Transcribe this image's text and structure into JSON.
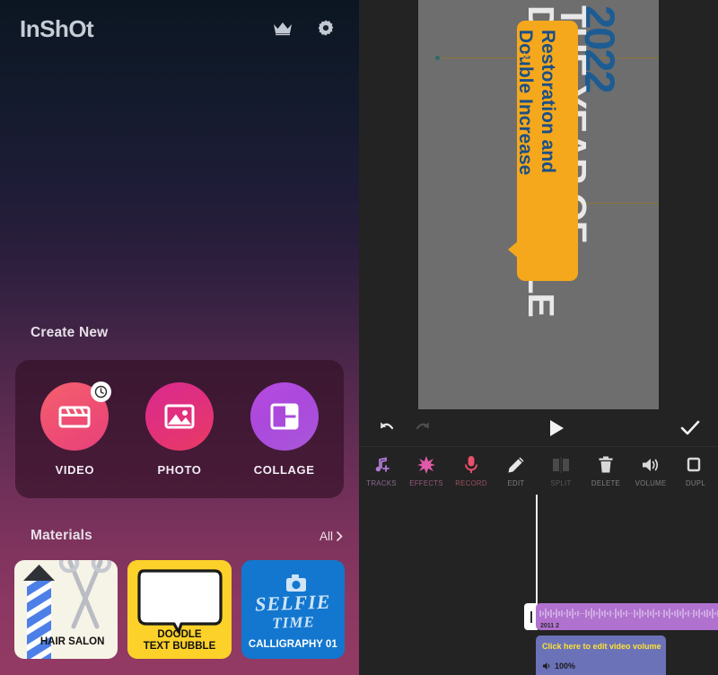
{
  "app": {
    "logo": "InShOt",
    "crown_icon": "crown-icon",
    "gear_icon": "gear-icon"
  },
  "create_new": {
    "title": "Create New",
    "items": [
      {
        "label": "VIDEO",
        "icon": "clapperboard-icon",
        "badge": "clock-icon",
        "color": "#ef4f72"
      },
      {
        "label": "PHOTO",
        "icon": "image-icon",
        "badge": "",
        "color": "#e0307e"
      },
      {
        "label": "COLLAGE",
        "icon": "collage-icon",
        "badge": "",
        "color": "#ab49dd"
      }
    ]
  },
  "materials": {
    "title": "Materials",
    "all_label": "All",
    "chevron_icon": "chevron-right-icon",
    "cards": [
      {
        "label": "HAIR SALON",
        "bg": "#f6f3e7",
        "text_color": "#12100e"
      },
      {
        "label": "DOODLE\nTEXT BUBBLE",
        "line1": "DOODLE",
        "line2": "TEXT BUBBLE",
        "bg": "#fcd12a",
        "text_color": "#12100e"
      },
      {
        "label": "CALLIGRAPHY 01",
        "bg": "#1377cf",
        "text_color": "#ffffff",
        "art_line1": "SELFIE",
        "art_line2": "TIME",
        "art_icon": "camera-icon"
      }
    ]
  },
  "editor": {
    "preview": {
      "year": "2022",
      "headline_line1": "THE YEAR OF",
      "headline_line2": "DOUBLE-DOUBLE",
      "bubble_line1": "Restoration and",
      "bubble_line2": "Double Increase",
      "year_color": "#1d5c93",
      "headline_color": "#e8e8e8",
      "bubble_color": "#f5a81c",
      "bubble_text_color": "#1c4f86",
      "canvas_color": "#6e6e6e"
    },
    "controls": {
      "undo_icon": "undo-icon",
      "redo_icon": "redo-icon",
      "play_icon": "play-icon",
      "confirm_icon": "check-icon"
    },
    "toolbar": [
      {
        "label": "TRACKS",
        "icon": "music-note-plus-icon",
        "color": "#b07ad6",
        "enabled": true
      },
      {
        "label": "EFFECTS",
        "icon": "starburst-icon",
        "color": "#e05aa8",
        "enabled": true
      },
      {
        "label": "RECORD",
        "icon": "microphone-icon",
        "color": "#e8516a",
        "enabled": true
      },
      {
        "label": "EDIT",
        "icon": "pencil-icon",
        "color": "#e6e6e6",
        "enabled": true
      },
      {
        "label": "SPLIT",
        "icon": "split-icon",
        "color": "#5a5a5a",
        "enabled": false
      },
      {
        "label": "DELETE",
        "icon": "trash-icon",
        "color": "#d8d8d8",
        "enabled": true
      },
      {
        "label": "VOLUME",
        "icon": "speaker-icon",
        "color": "#d8d8d8",
        "enabled": true
      },
      {
        "label": "DUPL",
        "icon": "duplicate-icon",
        "color": "#d8d8d8",
        "enabled": true
      }
    ],
    "timeline": {
      "audio_clip_label": "2011 2",
      "audio_clip_color": "#b071cf",
      "video_hint": "Click here to edit video volume",
      "video_hint_color": "#ffe234",
      "volume_value": "100%",
      "volume_icon": "speaker-small-icon",
      "video_clip_color": "#6b72b8"
    }
  }
}
